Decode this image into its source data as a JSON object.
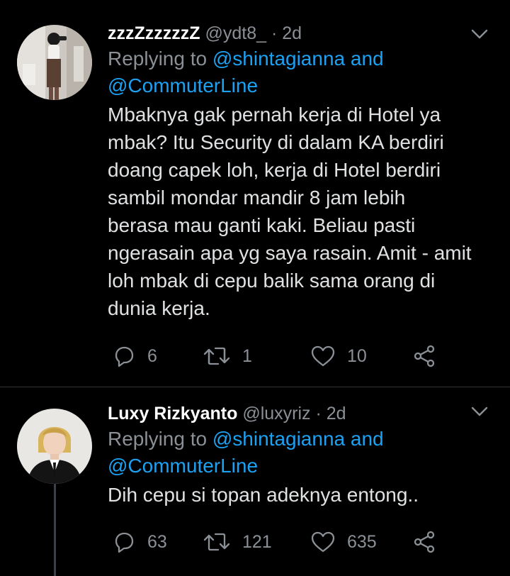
{
  "tweets": [
    {
      "name": "zzzZzzzzzZ",
      "handle": "@ydt8_",
      "separator": "·",
      "time": "2d",
      "replying_prefix": "Replying to",
      "mention1": "@shintagianna",
      "mention_joiner": "and",
      "mention2": "@CommuterLine",
      "text": "Mbaknya gak pernah kerja di Hotel ya\nmbak? Itu Security di dalam KA berdiri\ndoang capek loh, kerja di Hotel berdiri\nsambil mondar mandir 8 jam lebih\nberasa mau ganti kaki. Beliau pasti\nngerasain apa yg saya rasain. Amit - amit\nloh mbak di cepu balik sama orang di\ndunia kerja.",
      "replies": "6",
      "retweets": "1",
      "likes": "10",
      "avatar_icon": "user-photo-avatar"
    },
    {
      "name": "Luxy Rizkyanto",
      "handle": "@luxyriz",
      "separator": "·",
      "time": "2d",
      "replying_prefix": "Replying to",
      "mention1": "@shintagianna",
      "mention_joiner": "and",
      "mention2": "@CommuterLine",
      "text": "Dih cepu si topan adeknya entong..",
      "replies": "63",
      "retweets": "121",
      "likes": "635",
      "avatar_icon": "user-photo-avatar"
    }
  ],
  "colors": {
    "background": "#000000",
    "name": "#ffffff",
    "secondary": "#8b9096",
    "mention": "#1da1f2",
    "divider": "#2f3336"
  },
  "icons": {
    "reply": "reply-icon",
    "retweet": "retweet-icon",
    "like": "heart-icon",
    "share": "share-icon",
    "menu": "chevron-down-icon"
  }
}
